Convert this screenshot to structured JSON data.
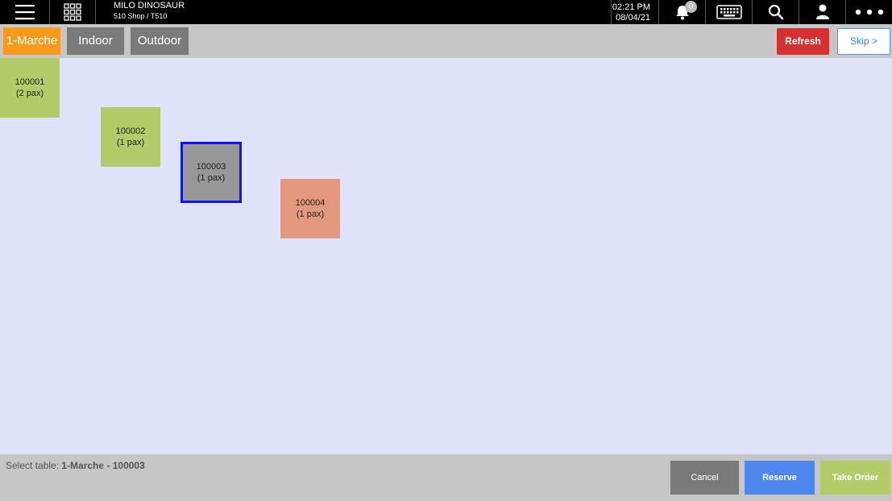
{
  "header": {
    "shop_name": "MILO DINOSAUR",
    "shop_sub": "510 Shop / T510",
    "time": "02:21 PM",
    "date": "08/04/21",
    "notification_count": "0",
    "icons": [
      "menu-icon",
      "apps-grid-icon",
      "bell-icon",
      "keyboard-icon",
      "search-icon",
      "user-icon",
      "more-icon"
    ]
  },
  "tabs": [
    {
      "label": "1-Marche",
      "active": true
    },
    {
      "label": "Indoor",
      "active": false
    },
    {
      "label": "Outdoor",
      "active": false
    }
  ],
  "actions": {
    "refresh": "Refresh",
    "skip": "Skip >"
  },
  "tables": [
    {
      "id": "100001",
      "pax": "(2 pax)",
      "status": "available"
    },
    {
      "id": "100002",
      "pax": "(1 pax)",
      "status": "available"
    },
    {
      "id": "100003",
      "pax": "(1 pax)",
      "status": "selected"
    },
    {
      "id": "100004",
      "pax": "(1 pax)",
      "status": "occupied"
    }
  ],
  "footer": {
    "select_label": "Select table: ",
    "select_value": "1-Marche - 100003",
    "cancel": "Cancel",
    "reserve": "Reserve",
    "take_order": "Take Order"
  },
  "colors": {
    "accent": "#f99a1c",
    "available": "#b3cb68",
    "selected_border": "#1414e6",
    "occupied": "#e4987f",
    "refresh": "#d43232",
    "reserve": "#4f86ec"
  }
}
